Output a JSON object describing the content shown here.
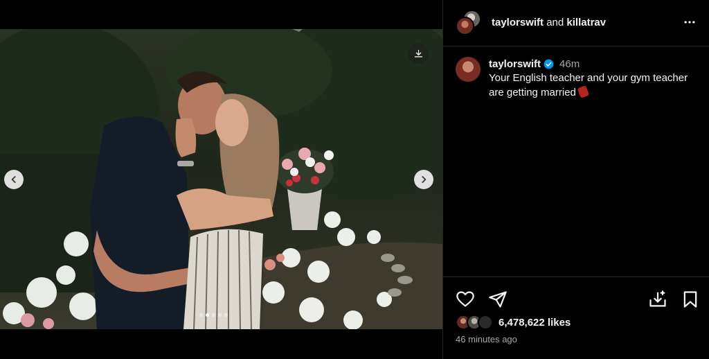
{
  "post": {
    "header": {
      "user1": "taylorswift",
      "conjunction": "and",
      "user2": "killatrav",
      "avatar1_icon": "avatar-killatrav",
      "avatar2_icon": "avatar-taylorswift",
      "more_icon": "more-horizontal-icon"
    },
    "caption": {
      "username": "taylorswift",
      "verified_icon": "verified-badge-icon",
      "time": "46m",
      "text": "Your English teacher and your gym teacher are getting married",
      "emoji_icon": "dynamite-emoji"
    },
    "media": {
      "carousel_dots": 5,
      "active_dot": 1,
      "prev_icon": "chevron-left-icon",
      "next_icon": "chevron-right-icon",
      "download_icon": "download-icon"
    },
    "actions": {
      "like_icon": "heart-icon",
      "share_icon": "paper-plane-icon",
      "save_draft_icon": "tray-download-icon",
      "bookmark_icon": "bookmark-icon"
    },
    "likes": "6,478,622 likes",
    "timestamp": "46 minutes ago"
  },
  "colors": {
    "background": "#000000",
    "text_primary": "#f5f5f5",
    "text_secondary": "#a8a8a8",
    "divider": "#262626",
    "verified_blue": "#0095f6"
  }
}
